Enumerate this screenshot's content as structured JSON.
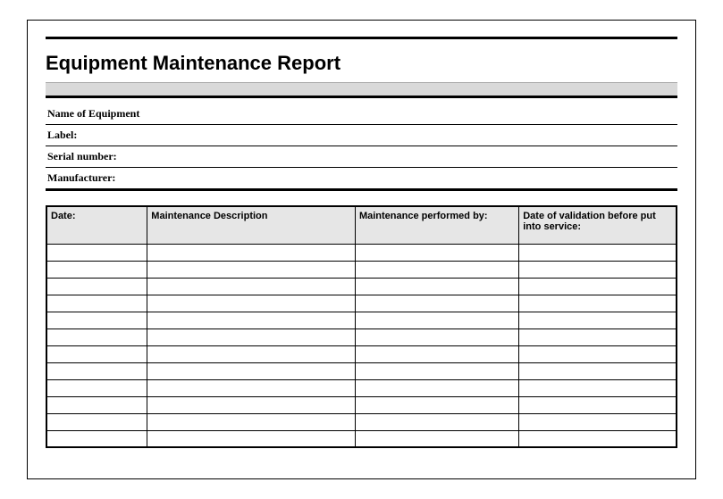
{
  "title": "Equipment Maintenance Report",
  "info_fields": [
    {
      "label": "Name of Equipment",
      "value": ""
    },
    {
      "label": "Label:",
      "value": ""
    },
    {
      "label": "Serial number:",
      "value": ""
    },
    {
      "label": "Manufacturer:",
      "value": ""
    }
  ],
  "log_columns": [
    "Date:",
    "Maintenance Description",
    "Maintenance performed by:",
    "Date of validation before put into service:"
  ],
  "log_rows": [
    [
      "",
      "",
      "",
      ""
    ],
    [
      "",
      "",
      "",
      ""
    ],
    [
      "",
      "",
      "",
      ""
    ],
    [
      "",
      "",
      "",
      ""
    ],
    [
      "",
      "",
      "",
      ""
    ],
    [
      "",
      "",
      "",
      ""
    ],
    [
      "",
      "",
      "",
      ""
    ],
    [
      "",
      "",
      "",
      ""
    ],
    [
      "",
      "",
      "",
      ""
    ],
    [
      "",
      "",
      "",
      ""
    ],
    [
      "",
      "",
      "",
      ""
    ],
    [
      "",
      "",
      "",
      ""
    ]
  ]
}
